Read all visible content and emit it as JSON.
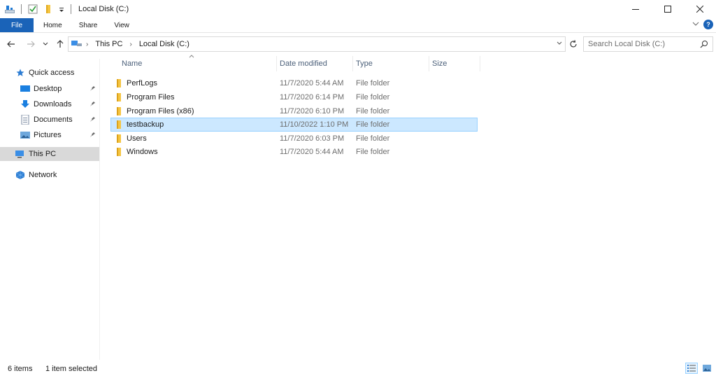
{
  "window": {
    "title": "Local Disk (C:)",
    "controls": {
      "minimize": "—",
      "maximize": "☐",
      "close": "✕"
    }
  },
  "ribbon": {
    "tabs": [
      "File",
      "Home",
      "Share",
      "View"
    ],
    "help": "?"
  },
  "address": {
    "crumbs": [
      "This PC",
      "Local Disk (C:)"
    ],
    "search_placeholder": "Search Local Disk (C:)"
  },
  "nav": {
    "quick_access": "Quick access",
    "pinned": [
      {
        "label": "Desktop",
        "icon": "desktop-icon"
      },
      {
        "label": "Downloads",
        "icon": "downloads-icon"
      },
      {
        "label": "Documents",
        "icon": "documents-icon"
      },
      {
        "label": "Pictures",
        "icon": "pictures-icon"
      }
    ],
    "this_pc": "This PC",
    "network": "Network"
  },
  "columns": [
    "Name",
    "Date modified",
    "Type",
    "Size"
  ],
  "files": [
    {
      "name": "PerfLogs",
      "date": "11/7/2020 5:44 AM",
      "type": "File folder",
      "selected": false
    },
    {
      "name": "Program Files",
      "date": "11/7/2020 6:14 PM",
      "type": "File folder",
      "selected": false
    },
    {
      "name": "Program Files (x86)",
      "date": "11/7/2020 6:10 PM",
      "type": "File folder",
      "selected": false
    },
    {
      "name": "testbackup",
      "date": "11/10/2022 1:10 PM",
      "type": "File folder",
      "selected": true
    },
    {
      "name": "Users",
      "date": "11/7/2020 6:03 PM",
      "type": "File folder",
      "selected": false
    },
    {
      "name": "Windows",
      "date": "11/7/2020 5:44 AM",
      "type": "File folder",
      "selected": false
    }
  ],
  "status": {
    "items": "6 items",
    "selected": "1 item selected"
  },
  "colors": {
    "accent": "#1a63b8",
    "selection_bg": "#cce8ff",
    "selection_border": "#99d1ff",
    "folder": "#f5c542"
  }
}
